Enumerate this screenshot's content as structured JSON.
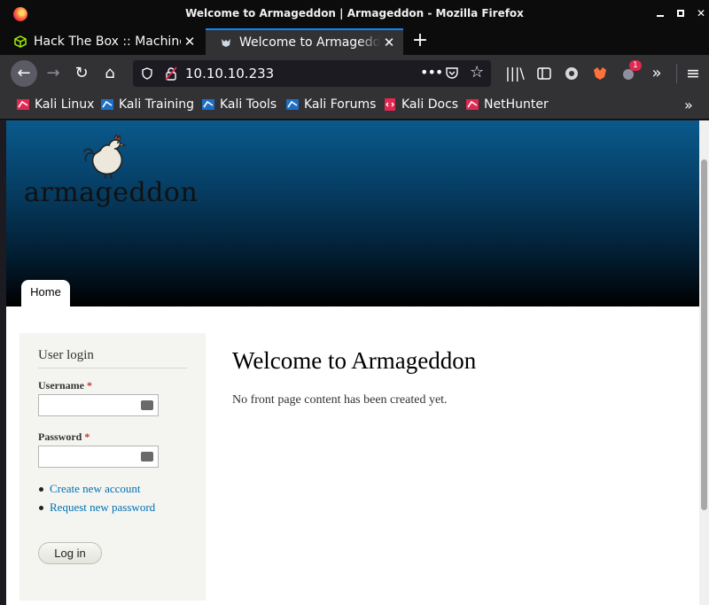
{
  "window": {
    "title": "Welcome to Armageddon | Armageddon - Mozilla Firefox",
    "minimize_icon": "minimize-icon",
    "maximize_icon": "maximize-icon",
    "close_icon": "close-icon"
  },
  "tabs": [
    {
      "label": "Hack The Box :: Machines",
      "icon": "htb-cube-icon",
      "close": "✕",
      "active": false
    },
    {
      "label": "Welcome to Armageddon",
      "icon": "drupal-icon",
      "close": "✕",
      "active": true
    }
  ],
  "new_tab": "+",
  "navbar": {
    "back": "←",
    "forward": "→",
    "reload": "↻",
    "home": "⌂",
    "url": "10.10.10.233",
    "more": "•••",
    "star": "☆",
    "library": "|||\\",
    "sidebar_icon": "sidebar-icon",
    "extension_badge": "1",
    "overflow": "»",
    "menu": "≡"
  },
  "bookmarks": [
    {
      "label": "Kali Linux",
      "icon": "kali-linux-icon"
    },
    {
      "label": "Kali Training",
      "icon": "kali-training-icon"
    },
    {
      "label": "Kali Tools",
      "icon": "kali-tools-icon"
    },
    {
      "label": "Kali Forums",
      "icon": "kali-forums-icon"
    },
    {
      "label": "Kali Docs",
      "icon": "kali-docs-icon"
    },
    {
      "label": "NetHunter",
      "icon": "nethunter-icon"
    }
  ],
  "bookmarks_overflow": "»",
  "site": {
    "name": "armageddon",
    "logo_icon": "rooster-logo-icon",
    "nav_home": "Home"
  },
  "login": {
    "heading": "User login",
    "username_label": "Username",
    "password_label": "Password",
    "required_mark": "*",
    "username_value": "",
    "password_value": "",
    "links": [
      "Create new account",
      "Request new password"
    ],
    "submit": "Log in"
  },
  "main": {
    "title": "Welcome to Armageddon",
    "text": "No front page content has been created yet."
  },
  "colors": {
    "link": "#0071b3",
    "required": "#cc3333",
    "banner_top": "#0a5a8c",
    "accent": "#0a84ff"
  }
}
